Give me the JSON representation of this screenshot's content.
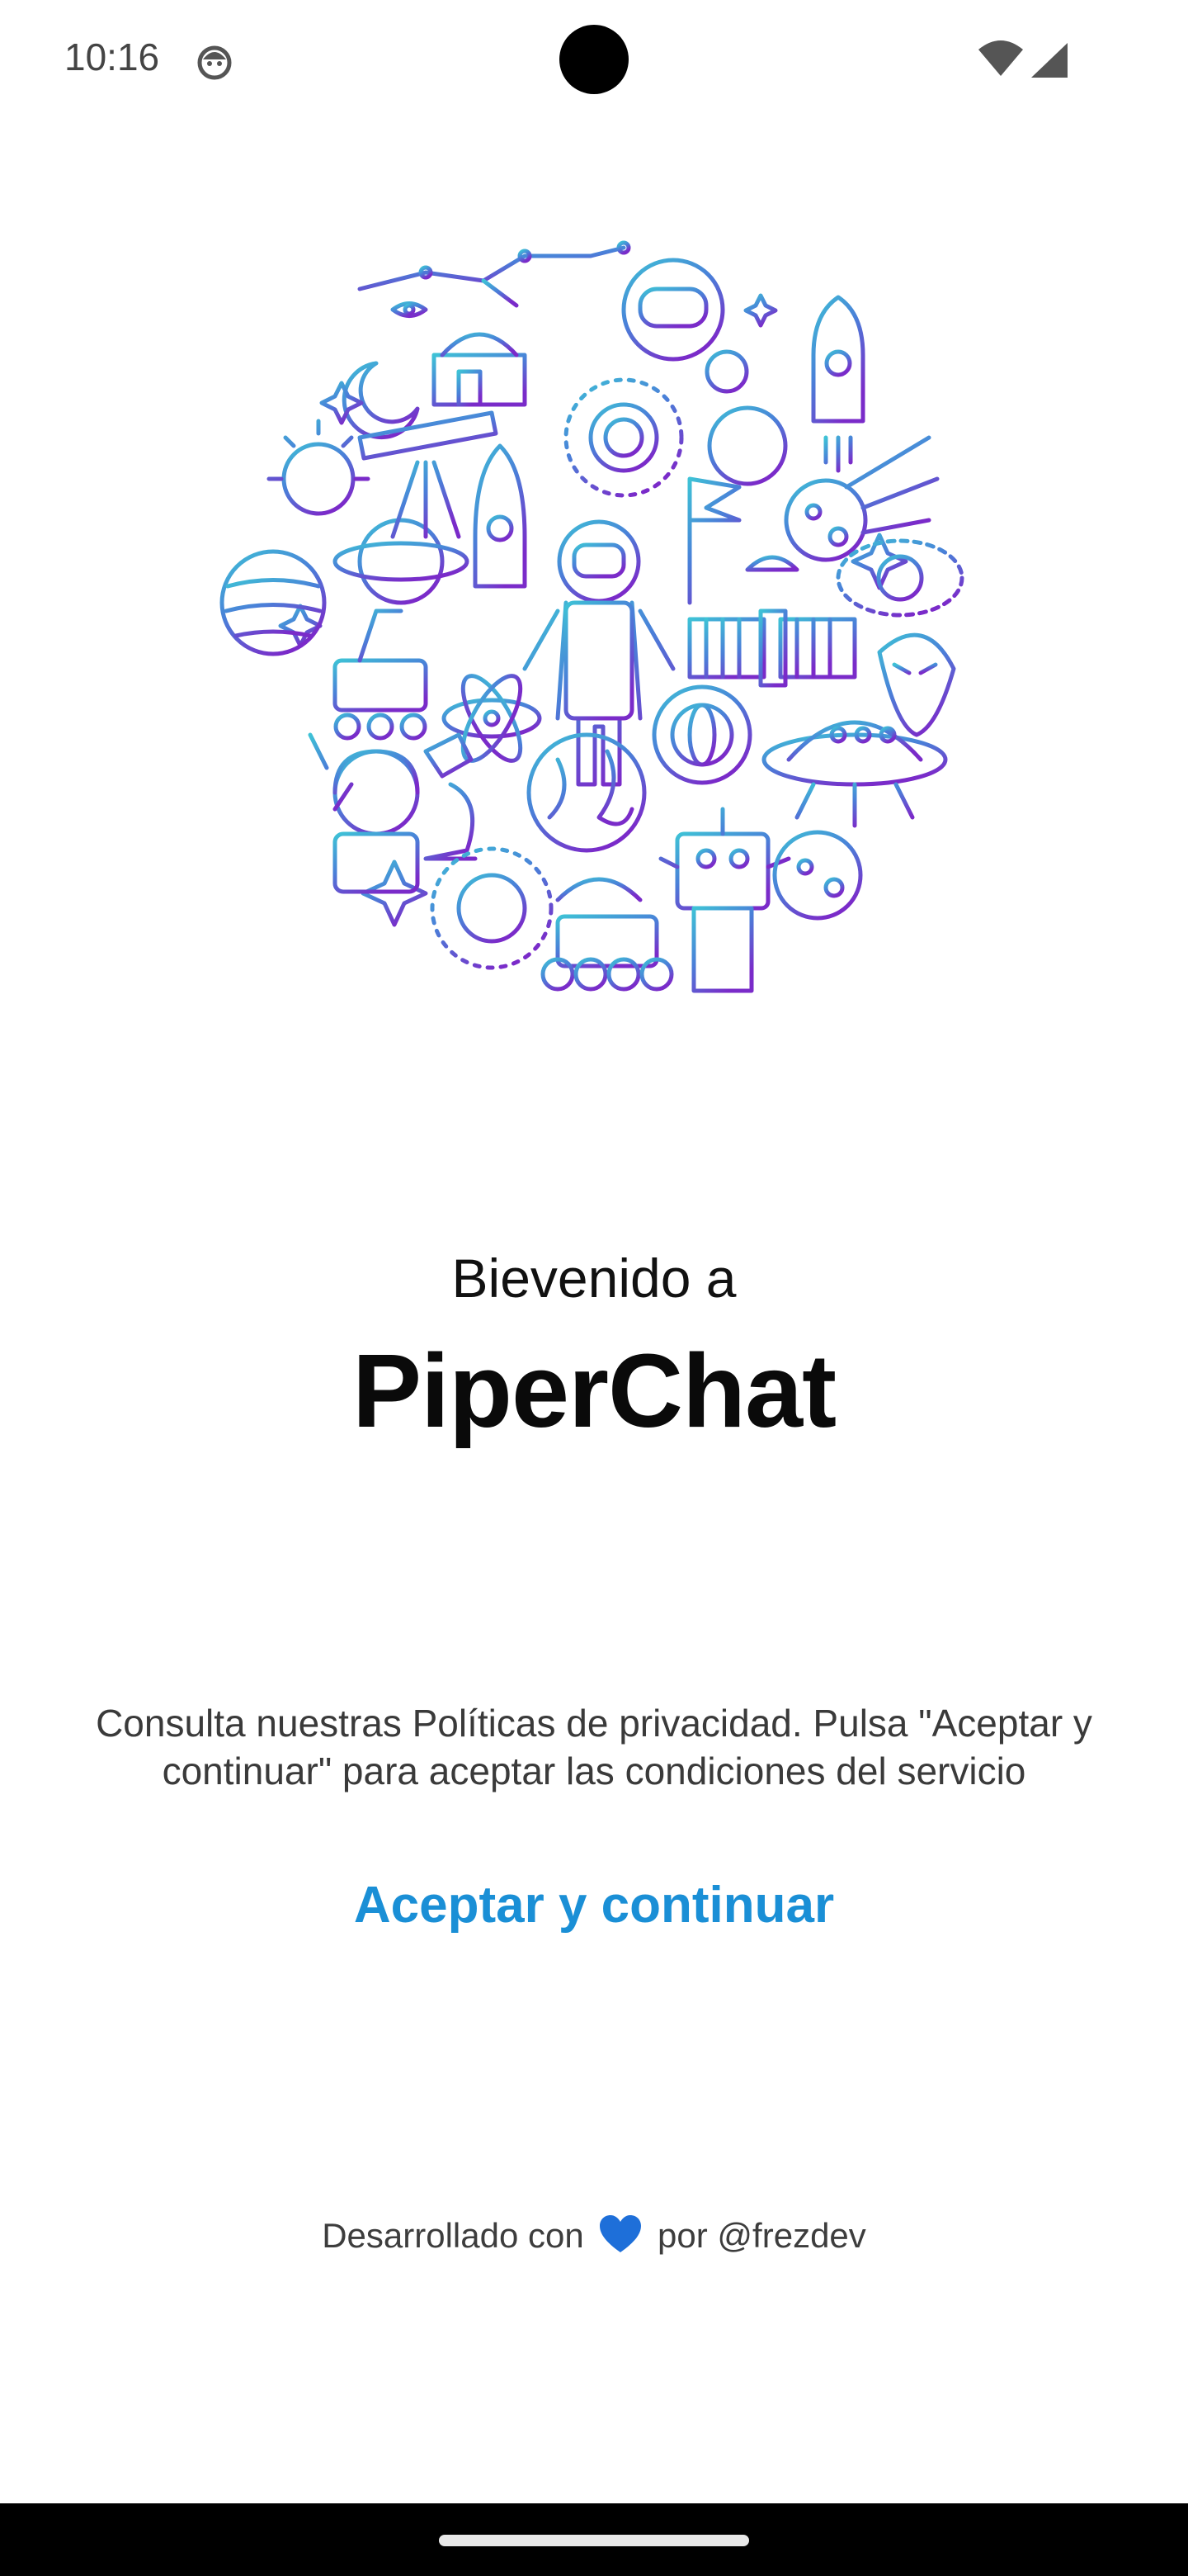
{
  "status_bar": {
    "time": "10:16",
    "notification_icon": "android-debug-icon",
    "wifi_icon": "wifi-icon",
    "signal_icon": "cellular-signal-icon"
  },
  "illustration": {
    "icon": "space-doodle-circle-illustration",
    "gradient_start": "#3ec2d6",
    "gradient_end": "#7a2bc9"
  },
  "welcome": {
    "line": "Bievenido a",
    "app_name": "PiperChat"
  },
  "policy_text": "Consulta nuestras Políticas de privacidad. Pulsa \"Aceptar y continuar\" para aceptar las condiciones del servicio",
  "accept_button_label": "Aceptar y continuar",
  "credit": {
    "prefix": "Desarrollado con",
    "heart_icon": "blue-heart-icon",
    "suffix": "por @frezdev"
  },
  "colors": {
    "accent": "#1a8fd6",
    "heart": "#1e6fd9"
  }
}
